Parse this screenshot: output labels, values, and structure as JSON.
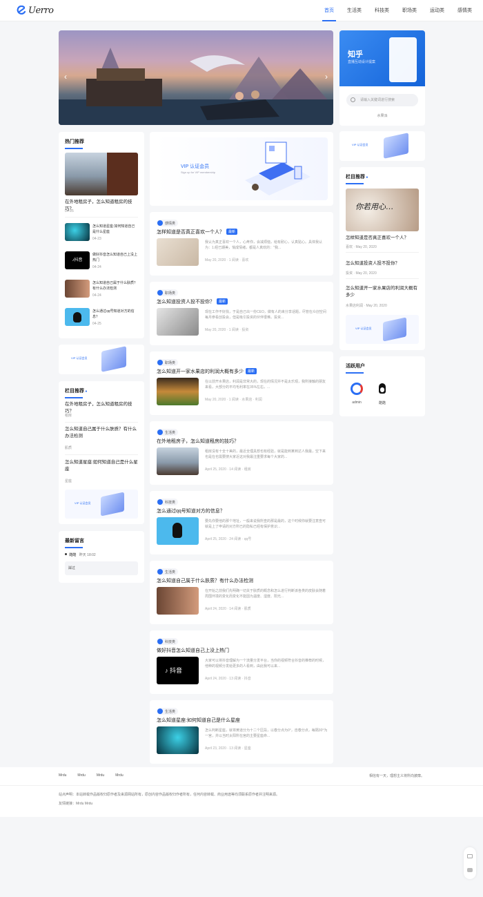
{
  "header": {
    "logo_text": "Uerro",
    "nav": [
      "首页",
      "生活类",
      "科技类",
      "职场类",
      "运动类",
      "感情类"
    ]
  },
  "promo": {
    "brand": "知乎",
    "subtitle": "直播互动设计提案",
    "search_placeholder": "请输入关键词进行搜索",
    "link": "水果派"
  },
  "vip": {
    "title": "VIP 认证会员",
    "subtitle": "Sign up for VIP membership"
  },
  "hot": {
    "title": "热门推荐",
    "feature": {
      "title": "在外地租房子，怎么知道租房的技巧？",
      "date": "04-25"
    },
    "items": [
      {
        "title": "怎么知道星座:如何知道自己是什么星座",
        "date": "04-23"
      },
      {
        "title": "做好抖音怎么知道自己上没上热门",
        "date": "04-24"
      },
      {
        "title": "怎么知道自己属于什么肤质？有什么办法检测",
        "date": "04-24"
      },
      {
        "title": "怎么通过qq号知道对方的信息？",
        "date": "04-25"
      }
    ]
  },
  "column_left": {
    "title": "栏目推荐",
    "items": [
      {
        "title": "在外地租房子，怎么知道租房的技巧？",
        "cat": "租房"
      },
      {
        "title": "怎么知道自己属于什么肤质？有什么办法检测",
        "cat": "肌质"
      },
      {
        "title": "怎么知道星座:如何知道自己是什么星座",
        "cat": "星座"
      }
    ]
  },
  "comments": {
    "title": "最新留言",
    "user": "酷酷",
    "time": "昨天 18:02",
    "text": "踩过"
  },
  "posts": [
    {
      "cat": "感情类",
      "title": "怎样知道是否真正喜欢一个人？",
      "isnew": true,
      "new_label": "最新",
      "excerpt": "我认为真正喜欢一个人，心疼你，会减烦恼，给有耐心，认真贴心。具体我认为：1.经已期美，悄成情绪，都是人真欢的：\"我...",
      "meta": "May 20, 2020 · 1 阅读 · 喜欢"
    },
    {
      "cat": "职场类",
      "title": "怎么知道投资人投不投你？",
      "isnew": true,
      "new_label": "最新",
      "excerpt": "现在工作不好找，于是自己出一份CEO，做有人的来分享话题，尽管在众创空间每月参看创投会，但是吸引投资的伙伴很难。投资...",
      "meta": "May 20, 2020 · 1 阅读 · 投资"
    },
    {
      "cat": "职场类",
      "title": "怎么知道开一家水果店的利润大概有多少",
      "isnew": true,
      "new_label": "最新",
      "excerpt": "在以前开水果店，利润是非常大的，现在的情况并不是太乐观，我所接触的朋友来看，大部分的平均毛利率在35%左右，...",
      "meta": "May 20, 2020 · 1 阅读 · 水果店 · 利润"
    },
    {
      "cat": "生活类",
      "title": "在外地租房子，怎么知道租房的技巧？",
      "isnew": false,
      "new_label": "",
      "excerpt": "租房没有十全十美的，最近全理具想也有经验，就是能到某到达人我最，空下来也是在也需要搜大家近这对我最注重要求每个大家的...",
      "meta": "April 25, 2020 · 14 阅读 · 租房"
    },
    {
      "cat": "科技类",
      "title": "怎么通过qq号知道对方的信息？",
      "isnew": false,
      "new_label": "",
      "excerpt": "要先你要他的那个地址，一般来说我所查的那是最的，这个时候你就要注意查可就是上了申请的对方所已的隐私已经有保护意识...",
      "meta": "April 25, 2020 · 24 阅读 · qq号"
    },
    {
      "cat": "生活类",
      "title": "怎么知道自己属于什么肤质？有什么办法检测",
      "isnew": false,
      "new_label": "",
      "excerpt": "在开始之前我们先明确一切关于肤质的概念和怎么进行判断该各类的皮肤会随着周围环境的变化而变化不能因为温度、湿度、阳光...",
      "meta": "April 24, 2020 · 14 阅读 · 肌质"
    },
    {
      "cat": "科技类",
      "title": "做好抖音怎么知道自己上没上热门",
      "isnew": false,
      "new_label": "",
      "excerpt": "大家可以将抖音理解为一个流量分发平台，当你的视频符合抖音的推荐的时候，他种的视频分发给更多的人看到，由此我可以来...",
      "meta": "April 24, 2020 · 13 阅读 · 抖音"
    },
    {
      "cat": "生活类",
      "title": "怎么知道星座:如何知道自己是什么星座",
      "isnew": false,
      "new_label": "",
      "excerpt": "怎么判断星座，就将黄道分为十二个区段，以春分点为0°，自春分点，每隔30°为一宫，并以当时太阳所在宫的主要星座命...",
      "meta": "April 23, 2020 · 13 阅读 · 星座"
    }
  ],
  "column_right": {
    "title": "栏目推荐",
    "feature": {
      "title": "怎样知道是否真正喜欢一个人？",
      "meta": "喜欢 · May 20, 2020"
    },
    "items": [
      {
        "title": "怎么知道投资人投不投你？",
        "meta": "投资 · May 20, 2020"
      },
      {
        "title": "怎么知道开一家水果店的利润大概有多少",
        "meta": "水果店利润 · May 20, 2020"
      }
    ]
  },
  "active_users": {
    "title": "活跃用户",
    "users": [
      "admin",
      "酷酷"
    ]
  },
  "footer": {
    "links": [
      "Mrdu",
      "Mrdu",
      "Mrdu",
      "Mrdu"
    ],
    "slogan": "相信有一天，理想主义将所向披靡。",
    "disclaimer": "站点声明：本站转载作品版权归原作者及来源网站所有，原创内容作品版权归作者所有，任何内容转载、商业用途等均须联系原作者并注明来源。",
    "friend_links": "友情链接：Mrdu Mrdu"
  },
  "colors": {
    "accent": "#2a6ef4",
    "background": "#f5f6f8"
  }
}
